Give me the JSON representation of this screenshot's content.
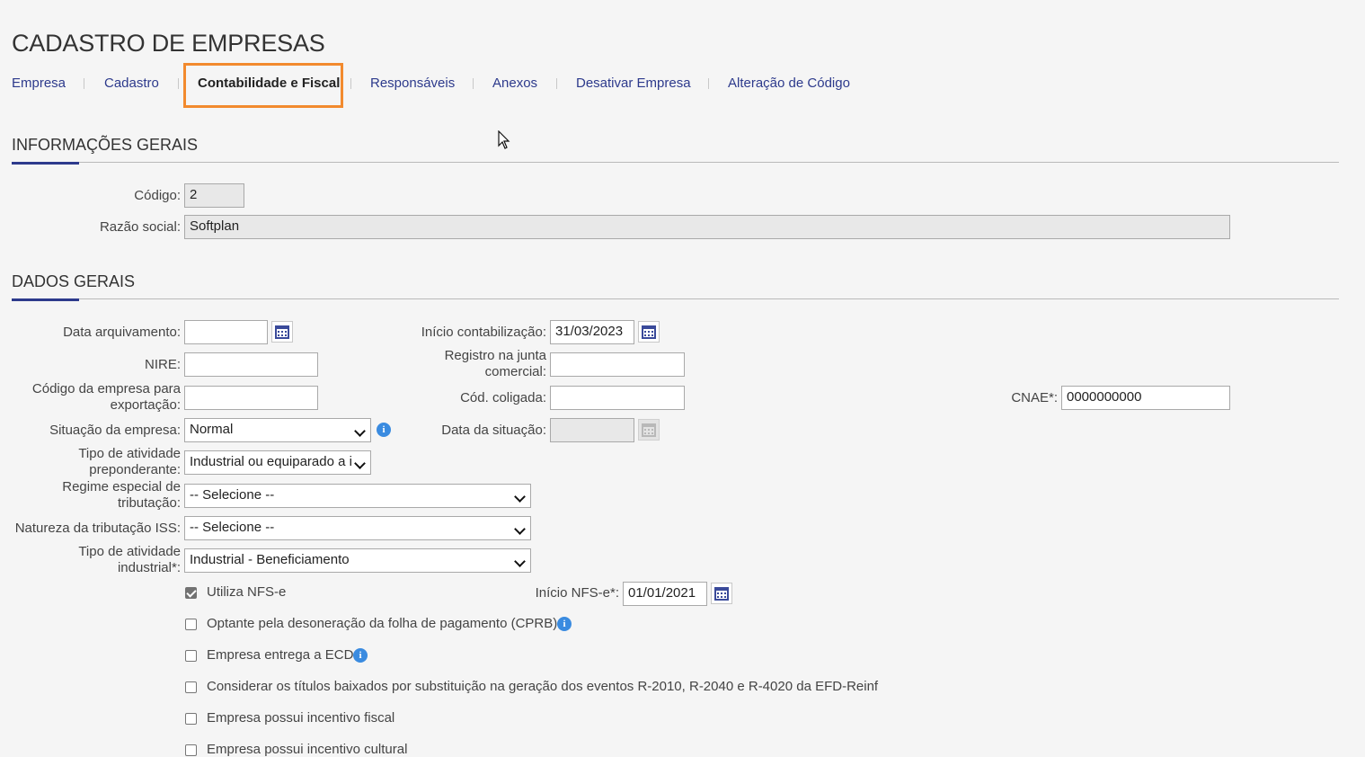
{
  "page": {
    "title": "CADASTRO DE EMPRESAS"
  },
  "tabs": [
    {
      "label": "Empresa"
    },
    {
      "label": "Cadastro"
    },
    {
      "label": "Contabilidade e Fiscal",
      "active": true
    },
    {
      "label": "Responsáveis"
    },
    {
      "label": "Anexos"
    },
    {
      "label": "Desativar Empresa"
    },
    {
      "label": "Alteração de Código"
    }
  ],
  "colors": {
    "accent": "#2d3a8c",
    "highlight": "#f28a2e",
    "info": "#3a8be0"
  },
  "info_section": {
    "title": "INFORMAÇÕES GERAIS",
    "codigo_label": "Código:",
    "codigo_value": "2",
    "razao_label": "Razão social:",
    "razao_value": "Softplan"
  },
  "dados": {
    "title": "DADOS GERAIS",
    "data_arquivamento_label": "Data arquivamento:",
    "data_arquivamento_value": "",
    "inicio_contab_label": "Início contabilização:",
    "inicio_contab_value": "31/03/2023",
    "nire_label": "NIRE:",
    "nire_value": "",
    "registro_junta_label_1": "Registro na junta",
    "registro_junta_label_2": "comercial:",
    "registro_junta_value": "",
    "cod_export_label_1": "Código da empresa para",
    "cod_export_label_2": "exportação:",
    "cod_export_value": "",
    "cod_coligada_label": "Cód. coligada:",
    "cod_coligada_value": "",
    "cnae_label": "CNAE*:",
    "cnae_value": "0000000000",
    "situacao_label": "Situação da empresa:",
    "situacao_value": "Normal",
    "data_situacao_label": "Data da situação:",
    "data_situacao_value": "",
    "tipo_ativ_pre_label_1": "Tipo de atividade",
    "tipo_ativ_pre_label_2": "preponderante:",
    "tipo_ativ_pre_value": "Industrial ou equiparado a i",
    "regime_label_1": "Regime especial de",
    "regime_label_2": "tributação:",
    "regime_value": "-- Selecione --",
    "natureza_iss_label": "Natureza da tributação ISS:",
    "natureza_iss_value": "-- Selecione --",
    "tipo_ativ_ind_label_1": "Tipo de atividade",
    "tipo_ativ_ind_label_2": "industrial*:",
    "tipo_ativ_ind_value": "Industrial - Beneficiamento",
    "inicio_nfse_label": "Início NFS-e*:",
    "inicio_nfse_value": "01/01/2021"
  },
  "checkboxes": [
    {
      "label": "Utiliza NFS-e",
      "checked": true
    },
    {
      "label": "Optante pela desoneração da folha de pagamento (CPRB)",
      "checked": false,
      "info": true
    },
    {
      "label": "Empresa entrega a ECD",
      "checked": false,
      "info": true
    },
    {
      "label": "Considerar os títulos baixados por substituição na geração dos eventos R-2010, R-2040 e R-4020 da EFD-Reinf",
      "checked": false
    },
    {
      "label": "Empresa possui incentivo fiscal",
      "checked": false
    },
    {
      "label": "Empresa possui incentivo cultural",
      "checked": false
    }
  ]
}
